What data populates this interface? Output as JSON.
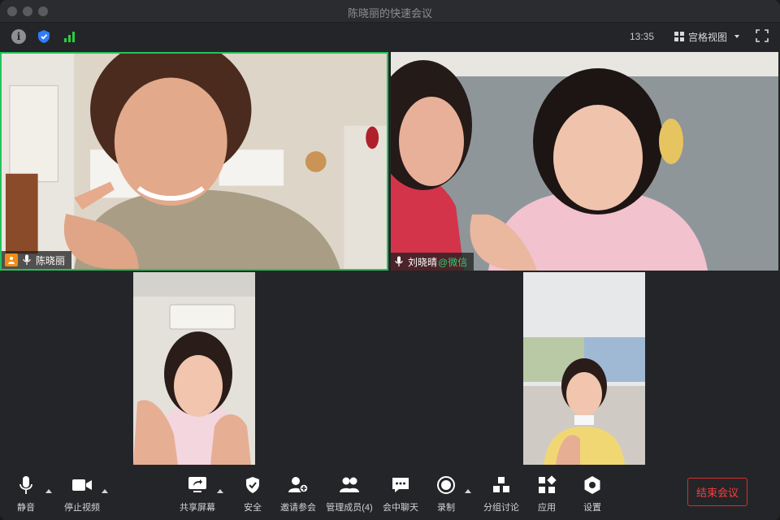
{
  "window": {
    "title": "陈晓丽的快速会议"
  },
  "infobar": {
    "time": "13:35",
    "view_label": "宫格视图",
    "icons": [
      "info-icon",
      "shield-icon",
      "signal-icon",
      "grid-icon",
      "fullscreen-icon"
    ]
  },
  "participants": [
    {
      "name": "陈晓丽",
      "host": true,
      "active_speaker": true,
      "suffix": ""
    },
    {
      "name": "刘晓晴",
      "host": false,
      "active_speaker": false,
      "suffix": "@微信"
    },
    {
      "name": "",
      "host": false,
      "active_speaker": false,
      "suffix": ""
    },
    {
      "name": "",
      "host": false,
      "active_speaker": false,
      "suffix": ""
    }
  ],
  "toolbar": {
    "mute": "静音",
    "stop_video": "停止视频",
    "share_screen": "共享屏幕",
    "security": "安全",
    "invite": "邀请参会",
    "manage_participants": "管理成员(4)",
    "chat": "会中聊天",
    "record": "录制",
    "breakout": "分组讨论",
    "apps": "应用",
    "settings": "设置",
    "end_meeting": "结束会议"
  },
  "colors": {
    "active_border": "#23c35c",
    "host_badge": "#f08c1a",
    "end_button": "#e02b2b",
    "wechat_suffix": "#2ecc71",
    "shield": "#2f7cf6",
    "signal": "#2ecc40"
  }
}
